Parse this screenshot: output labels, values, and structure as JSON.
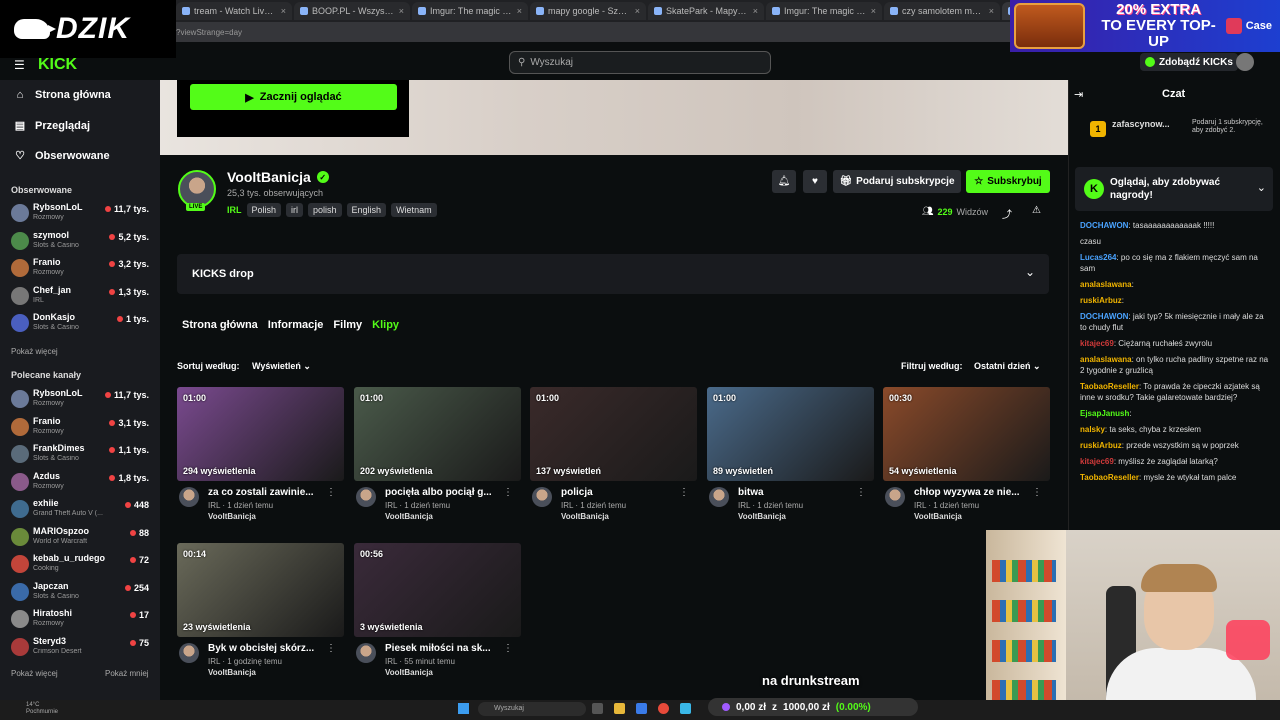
{
  "browser": {
    "tabs": [
      "tream - Watch Live on",
      "BOOP.PL - Wszystko co chcesz",
      "Imgur: The magic of the Intern",
      "mapy google - Szukaj w Googl",
      "SkatePark - Mapy Google",
      "Imgur: The magic of the Intern",
      "czy samolotem mozna medycz",
      "VooltBanicja"
    ],
    "url": "?viewStrange=day"
  },
  "overlay": {
    "logo_text": "DZIK",
    "promo_line1": "20% EXTRA",
    "promo_line2": "TO EVERY TOP-UP",
    "promo_brand": "Case",
    "stream_caption": "na drunkstream",
    "donation": {
      "amount": "0,00 zł",
      "sep": "z",
      "goal": "1000,00 zł",
      "pct": "(0.00%)"
    }
  },
  "header": {
    "logo": "KICK",
    "search_placeholder": "Wyszukaj",
    "get_kicks": "Zdobądź KICKs"
  },
  "sidebar": {
    "nav": [
      {
        "label": "Strona główna",
        "icon": "home-icon"
      },
      {
        "label": "Przeglądaj",
        "icon": "browse-icon"
      },
      {
        "label": "Obserwowane",
        "icon": "heart-icon"
      }
    ],
    "followed_title": "Obserwowane",
    "followed": [
      {
        "name": "RybsonLoL",
        "cat": "Rozmowy",
        "viewers": "11,7 tys.",
        "color": "#6b7a99"
      },
      {
        "name": "szymool",
        "cat": "Slots & Casino",
        "viewers": "5,2 tys.",
        "color": "#4c8a4a"
      },
      {
        "name": "Franio",
        "cat": "Rozmowy",
        "viewers": "3,2 tys.",
        "color": "#b06a3a"
      },
      {
        "name": "Chef_jan",
        "cat": "IRL",
        "viewers": "1,3 tys.",
        "color": "#777777"
      },
      {
        "name": "DonKasjo",
        "cat": "Slots & Casino",
        "viewers": "1 tys.",
        "color": "#4a5fbf"
      }
    ],
    "followed_more": "Pokaż więcej",
    "recommended_title": "Polecane kanały",
    "recommended": [
      {
        "name": "RybsonLoL",
        "cat": "Rozmowy",
        "viewers": "11,7 tys.",
        "color": "#6b7a99"
      },
      {
        "name": "Franio",
        "cat": "Rozmowy",
        "viewers": "3,1 tys.",
        "color": "#b06a3a"
      },
      {
        "name": "FrankDimes",
        "cat": "Slots & Casino",
        "viewers": "1,1 tys.",
        "color": "#5a6b7a"
      },
      {
        "name": "Azdus",
        "cat": "Rozmowy",
        "viewers": "1,8 tys.",
        "color": "#8a5a8a"
      },
      {
        "name": "exhiie",
        "cat": "Grand Theft Auto V (...",
        "viewers": "448",
        "color": "#3f6b8f"
      },
      {
        "name": "MARIOspzoo",
        "cat": "World of Warcraft",
        "viewers": "88",
        "color": "#6a8a3a"
      },
      {
        "name": "kebab_u_rudego",
        "cat": "Cooking",
        "viewers": "72",
        "color": "#c2453a"
      },
      {
        "name": "Japczan",
        "cat": "Slots & Casino",
        "viewers": "254",
        "color": "#3a6aa8"
      },
      {
        "name": "Hiratoshi",
        "cat": "Rozmowy",
        "viewers": "17",
        "color": "#8a8a8a"
      },
      {
        "name": "Steryd3",
        "cat": "Crimson Desert",
        "viewers": "75",
        "color": "#a83a3a"
      }
    ],
    "show_more": "Pokaż więcej",
    "show_less": "Pokaż mniej"
  },
  "channel": {
    "start_watching": "Zacznij oglądać",
    "name": "VooltBanicja",
    "live": "LIVE",
    "followers": "25,3 tys. obserwujących",
    "category": "IRL",
    "tags": [
      "Polish",
      "irl",
      "polish",
      "English",
      "Wietnam"
    ],
    "gift_label": "Podaruj subskrypcje",
    "sub_label": "Subskrybuj",
    "viewers": "229",
    "viewers_label": "Widzów"
  },
  "kicks_drop": "KICKS drop",
  "tabs": [
    "Strona główna",
    "Informacje",
    "Filmy",
    "Klipy"
  ],
  "sort": {
    "label": "Sortuj według:",
    "value": "Wyświetleń"
  },
  "filter": {
    "label": "Filtruj według:",
    "value": "Ostatni dzień"
  },
  "clips": [
    {
      "dur": "01:00",
      "views": "294 wyświetlenia",
      "title": "za co zostali zawinie...",
      "meta": "IRL · 1 dzień temu",
      "author": "VooltBanicja",
      "thumb": "#7a4a8f"
    },
    {
      "dur": "01:00",
      "views": "202 wyświetlenia",
      "title": "pocięła albo pociął g...",
      "meta": "IRL · 1 dzień temu",
      "author": "VooltBanicja",
      "thumb": "#4a5a4a"
    },
    {
      "dur": "01:00",
      "views": "137 wyświetleń",
      "title": "policja",
      "meta": "IRL · 1 dzień temu",
      "author": "VooltBanicja",
      "thumb": "#3a2a2a"
    },
    {
      "dur": "01:00",
      "views": "89 wyświetleń",
      "title": "bitwa",
      "meta": "IRL · 1 dzień temu",
      "author": "VooltBanicja",
      "thumb": "#4a6a8a"
    },
    {
      "dur": "00:30",
      "views": "54 wyświetlenia",
      "title": "chłop wyzywa ze nie...",
      "meta": "IRL · 1 dzień temu",
      "author": "VooltBanicja",
      "thumb": "#8a4a2a"
    },
    {
      "dur": "00:14",
      "views": "23 wyświetlenia",
      "title": "Byk w obcisłej skórz...",
      "meta": "IRL · 1 godzinę temu",
      "author": "VooltBanicja",
      "thumb": "#6a6a5a"
    },
    {
      "dur": "00:56",
      "views": "3 wyświetlenia",
      "title": "Piesek miłości na sk...",
      "meta": "IRL · 55 minut temu",
      "author": "VooltBanicja",
      "thumb": "#3a2a3a"
    }
  ],
  "chat": {
    "title": "Czat",
    "pinned_rank": "1",
    "pinned_user": "zafascynow...",
    "pinned_text": "Podaruj 1 subskrypcję, aby zdobyć 2.",
    "reward_text": "Oglądaj, aby zdobywać nagrody!",
    "messages": [
      {
        "user": "DOCHAWON",
        "color": "#4aa3ff",
        "text": "tasaaaaaaaaaaaak !!!!!"
      },
      {
        "user": "",
        "color": "#ddd",
        "text": "czasu"
      },
      {
        "user": "Lucas264",
        "color": "#4aa3ff",
        "text": "po co się ma z flakiem męczyć sam na sam"
      },
      {
        "user": "analaslawana",
        "color": "#f0b400",
        "text": ""
      },
      {
        "user": "ruskiArbuz",
        "color": "#f0b400",
        "text": ""
      },
      {
        "user": "DOCHAWON",
        "color": "#4aa3ff",
        "text": "jaki typ? 5k miesięcznie i mały ale za to chudy flut"
      },
      {
        "user": "kitajec69",
        "color": "#d03a3a",
        "text": "Ciężarną ruchałeś zwyrolu"
      },
      {
        "user": "analaslawana",
        "color": "#f0b400",
        "text": "on tylko rucha padliny szpetne raz na 2 tygodnie z grużlicą"
      },
      {
        "user": "TaobaoReseller",
        "color": "#f0b400",
        "text": "To prawda że cipeczki azjatek są inne w srodku? Takie galaretowate bardziej?"
      },
      {
        "user": "EjsapJanush",
        "color": "#53fc18",
        "text": ""
      },
      {
        "user": "nalsky",
        "color": "#f0b400",
        "text": "ta seks, chyba z krzesłem"
      },
      {
        "user": "ruskiArbuz",
        "color": "#f0b400",
        "text": "przede wszystkim są w poprzek"
      },
      {
        "user": "kitajec69",
        "color": "#d03a3a",
        "text": "myślisz że zaglądał latarką?"
      },
      {
        "user": "TaobaoReseller",
        "color": "#f0b400",
        "text": "mysle że wtykał tam palce"
      }
    ]
  },
  "taskbar": {
    "weather_temp": "14°C",
    "weather_desc": "Pochmurnie",
    "search": "Wyszukaj"
  }
}
